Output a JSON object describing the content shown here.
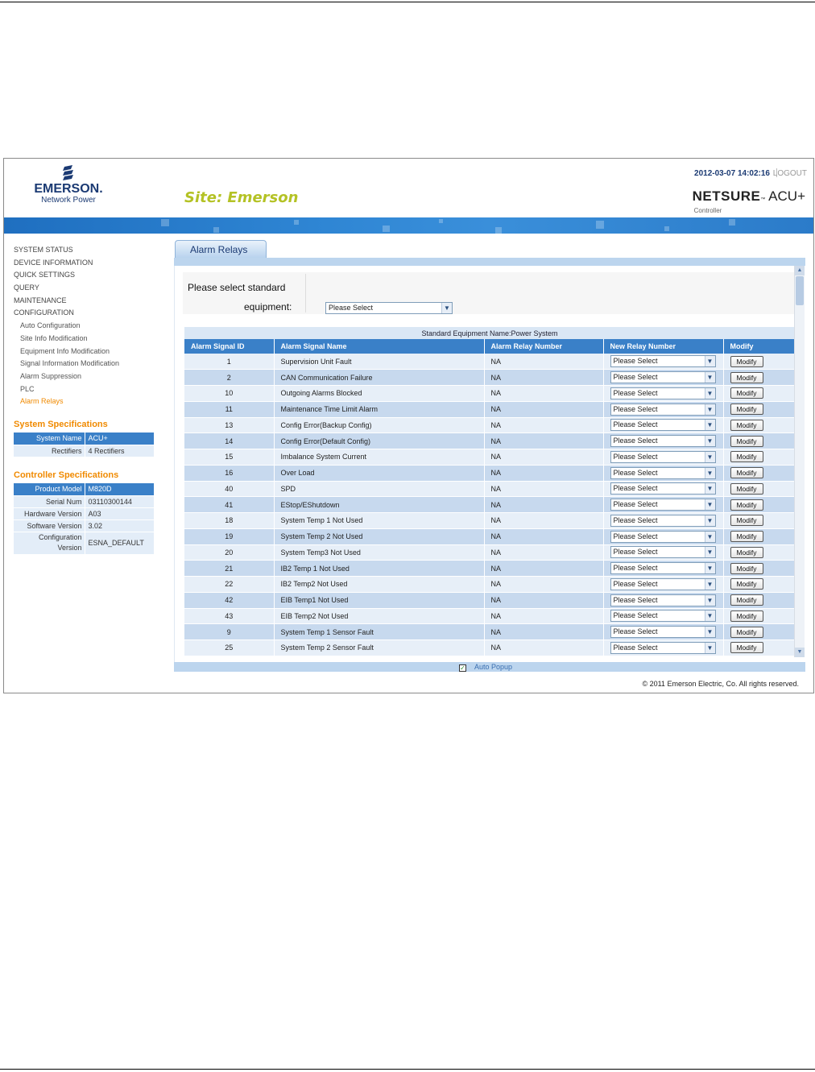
{
  "header": {
    "logo_word": "EMERSON.",
    "logo_sub": "Network Power",
    "site_title": "Site: Emerson",
    "datetime": "2012-03-07 14:02:16",
    "logout": "LOGOUT",
    "brand_main": "NETSURE",
    "brand_suffix": "ACU+",
    "brand_sub": "Controller"
  },
  "nav": {
    "items": [
      {
        "label": "SYSTEM STATUS"
      },
      {
        "label": "DEVICE INFORMATION"
      },
      {
        "label": "QUICK SETTINGS"
      },
      {
        "label": "QUERY"
      },
      {
        "label": "MAINTENANCE"
      },
      {
        "label": "CONFIGURATION"
      }
    ],
    "sub_items": [
      {
        "label": "Auto Configuration"
      },
      {
        "label": "Site Info Modification"
      },
      {
        "label": "Equipment Info Modification"
      },
      {
        "label": "Signal Information Modification"
      },
      {
        "label": "Alarm Suppression"
      },
      {
        "label": "PLC"
      },
      {
        "label": "Alarm Relays"
      }
    ]
  },
  "system_specs": {
    "title": "System Specifications",
    "rows": [
      {
        "key": "System Name",
        "value": "ACU+"
      },
      {
        "key": "Rectifiers",
        "value": "4 Rectifiers"
      }
    ]
  },
  "controller_specs": {
    "title": "Controller Specifications",
    "rows": [
      {
        "key": "Product Model",
        "value": "M820D"
      },
      {
        "key": "Serial Num",
        "value": "03110300144"
      },
      {
        "key": "Hardware Version",
        "value": "A03"
      },
      {
        "key": "Software Version",
        "value": "3.02"
      },
      {
        "key": "Configuration Version",
        "value": "ESNA_DEFAULT"
      }
    ]
  },
  "main": {
    "tab_label": "Alarm Relays",
    "select_label_1": "Please select standard",
    "select_label_2": "equipment:",
    "equipment_select_value": "Please Select",
    "table_caption": "Standard Equipment Name:Power System",
    "columns": [
      "Alarm Signal ID",
      "Alarm Signal Name",
      "Alarm Relay Number",
      "New Relay Number",
      "Modify"
    ],
    "select_value": "Please Select",
    "modify_label": "Modify",
    "rows": [
      {
        "id": "1",
        "name": "Supervision Unit Fault",
        "relay": "NA"
      },
      {
        "id": "2",
        "name": "CAN Communication Failure",
        "relay": "NA"
      },
      {
        "id": "10",
        "name": "Outgoing Alarms Blocked",
        "relay": "NA"
      },
      {
        "id": "11",
        "name": "Maintenance Time Limit Alarm",
        "relay": "NA"
      },
      {
        "id": "13",
        "name": "Config Error(Backup Config)",
        "relay": "NA"
      },
      {
        "id": "14",
        "name": "Config Error(Default Config)",
        "relay": "NA"
      },
      {
        "id": "15",
        "name": "Imbalance System Current",
        "relay": "NA"
      },
      {
        "id": "16",
        "name": "Over Load",
        "relay": "NA"
      },
      {
        "id": "40",
        "name": "SPD",
        "relay": "NA"
      },
      {
        "id": "41",
        "name": "EStop/EShutdown",
        "relay": "NA"
      },
      {
        "id": "18",
        "name": "System Temp 1 Not Used",
        "relay": "NA"
      },
      {
        "id": "19",
        "name": "System Temp 2 Not Used",
        "relay": "NA"
      },
      {
        "id": "20",
        "name": "System Temp3 Not Used",
        "relay": "NA"
      },
      {
        "id": "21",
        "name": "IB2 Temp 1 Not Used",
        "relay": "NA"
      },
      {
        "id": "22",
        "name": "IB2 Temp2 Not Used",
        "relay": "NA"
      },
      {
        "id": "42",
        "name": "EIB Temp1 Not Used",
        "relay": "NA"
      },
      {
        "id": "43",
        "name": "EIB Temp2 Not Used",
        "relay": "NA"
      },
      {
        "id": "9",
        "name": "System Temp 1 Sensor Fault",
        "relay": "NA"
      },
      {
        "id": "25",
        "name": "System Temp 2 Sensor Fault",
        "relay": "NA"
      }
    ]
  },
  "footer": {
    "auto_popup_label": "Auto Popup",
    "auto_popup_checked": true,
    "copyright": "© 2011 Emerson Electric, Co. All rights reserved."
  },
  "colors": {
    "accent_orange": "#f08a00",
    "header_blue": "#3a80c8",
    "site_title_green": "#b4c225",
    "brand_navy": "#1b3a73"
  }
}
